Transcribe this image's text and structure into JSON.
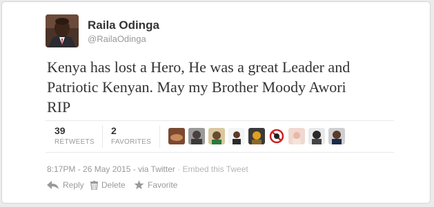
{
  "profile": {
    "name": "Raila Odinga",
    "handle": "@RailaOdinga",
    "avatar_icon": "profile-photo"
  },
  "tweet": {
    "line1": "Kenya has lost a Hero, He was a great Leader and",
    "line2": "Patriotic Kenyan. May my Brother Moody Awori",
    "line3": "RIP"
  },
  "stats": {
    "retweets_count": "39",
    "retweets_label": "RETWEETS",
    "favorites_count": "2",
    "favorites_label": "FAVORITES"
  },
  "meta": {
    "timestamp": "8:17PM - 26 May 2015",
    "via": " - via Twitter",
    "embed": " · Embed this Tweet"
  },
  "actions": {
    "reply": "Reply",
    "delete": "Delete",
    "favorite": "Favorite"
  },
  "colors": {
    "text": "#333333",
    "muted": "#999999"
  }
}
